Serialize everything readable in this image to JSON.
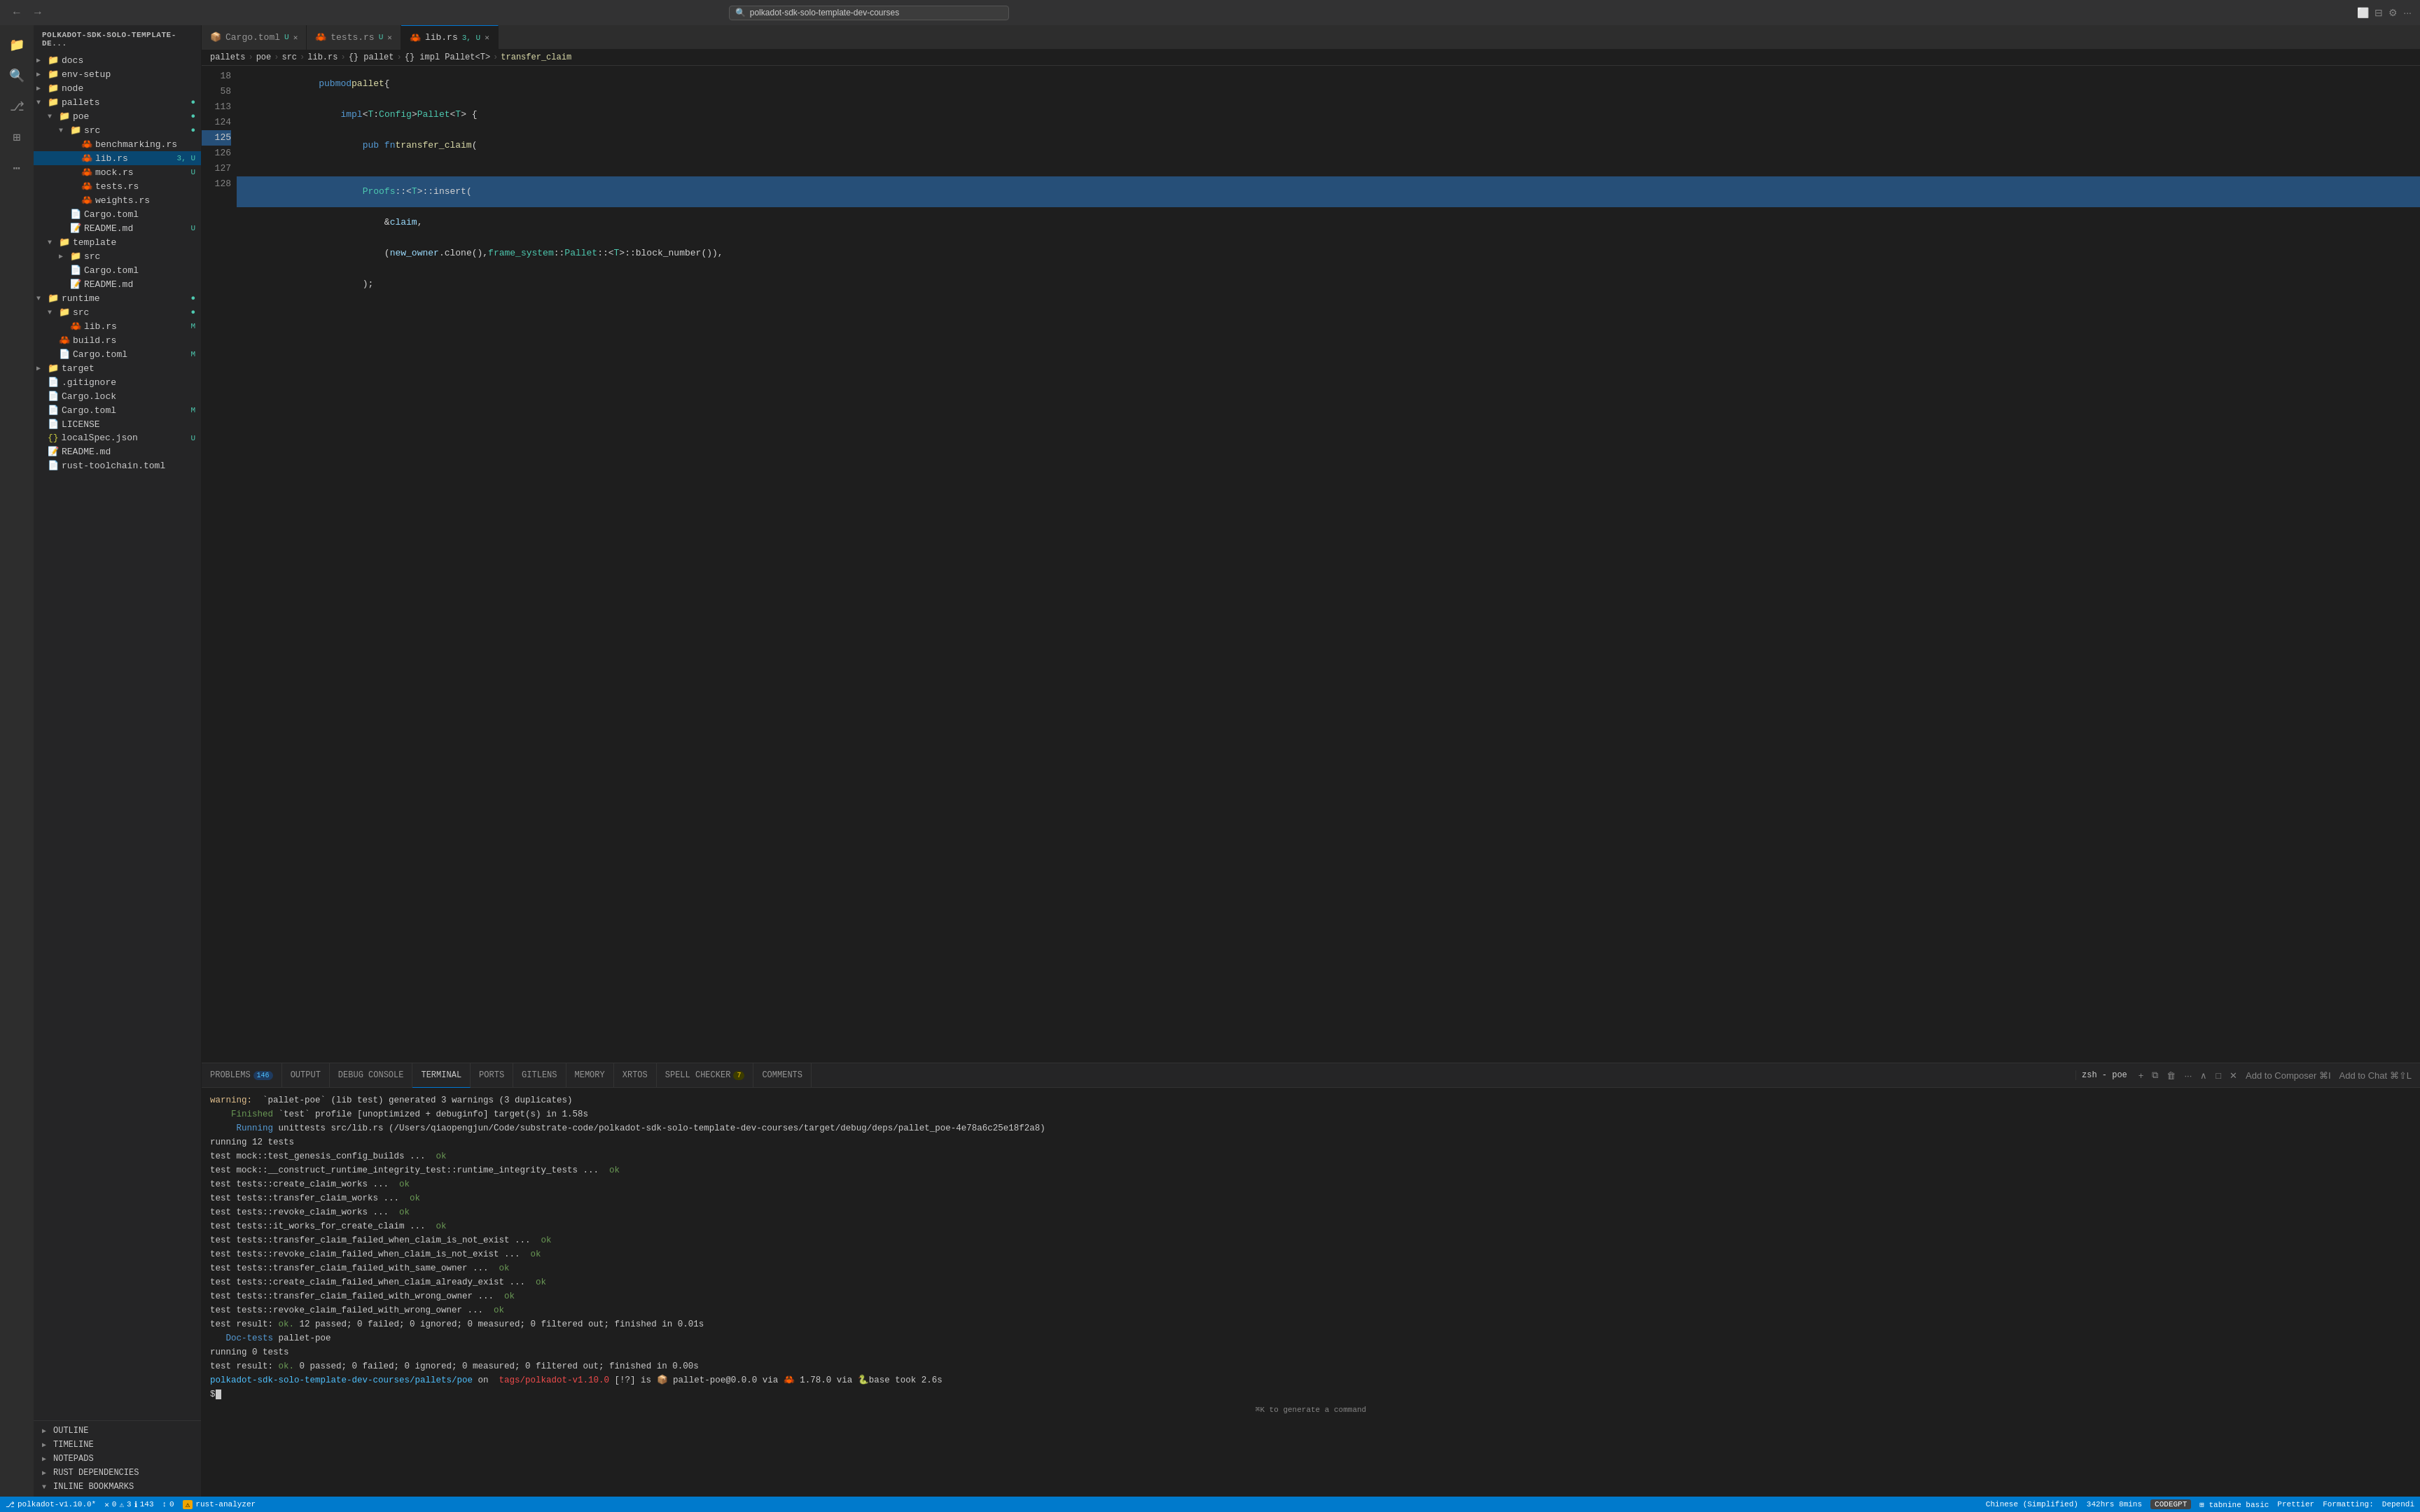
{
  "titlebar": {
    "search_value": "polkadot-sdk-solo-template-dev-courses",
    "search_placeholder": "polkadot-sdk-solo-template-dev-courses"
  },
  "tabs": [
    {
      "id": "cargo-toml",
      "label": "Cargo.toml",
      "badge": "U",
      "active": false,
      "icon": "📦"
    },
    {
      "id": "tests-rs",
      "label": "tests.rs",
      "badge": "U",
      "active": false,
      "icon": "🦀"
    },
    {
      "id": "lib-rs",
      "label": "lib.rs",
      "badge": "3, U",
      "active": true,
      "icon": "🦀"
    }
  ],
  "breadcrumb": {
    "items": [
      "pallets",
      "poe",
      "src",
      "lib.rs",
      "{} pallet",
      "{} impl Pallet<T>",
      "transfer_claim"
    ]
  },
  "sidebar": {
    "title": "POLKADOT-SDK-SOLO-TEMPLATE-DE...",
    "tree": [
      {
        "id": "docs",
        "label": "docs",
        "type": "folder",
        "depth": 0,
        "expanded": false,
        "badge": ""
      },
      {
        "id": "env-setup",
        "label": "env-setup",
        "type": "folder",
        "depth": 0,
        "expanded": false,
        "badge": ""
      },
      {
        "id": "node",
        "label": "node",
        "type": "folder",
        "depth": 0,
        "expanded": false,
        "badge": ""
      },
      {
        "id": "pallets",
        "label": "pallets",
        "type": "folder",
        "depth": 0,
        "expanded": true,
        "badge": "●"
      },
      {
        "id": "poe",
        "label": "poe",
        "type": "folder",
        "depth": 1,
        "expanded": true,
        "badge": "●"
      },
      {
        "id": "src",
        "label": "src",
        "type": "folder",
        "depth": 2,
        "expanded": true,
        "badge": "●"
      },
      {
        "id": "benchmarking-rs",
        "label": "benchmarking.rs",
        "type": "file-rust",
        "depth": 3,
        "expanded": false,
        "badge": ""
      },
      {
        "id": "lib-rs",
        "label": "lib.rs",
        "type": "file-rust",
        "depth": 3,
        "expanded": false,
        "badge": "3, U",
        "selected": true
      },
      {
        "id": "mock-rs",
        "label": "mock.rs",
        "type": "file-rust",
        "depth": 3,
        "expanded": false,
        "badge": "U"
      },
      {
        "id": "tests-rs",
        "label": "tests.rs",
        "type": "file-rust",
        "depth": 3,
        "expanded": false,
        "badge": ""
      },
      {
        "id": "weights-rs",
        "label": "weights.rs",
        "type": "file-rust",
        "depth": 3,
        "expanded": false,
        "badge": ""
      },
      {
        "id": "cargo-toml-poe",
        "label": "Cargo.toml",
        "type": "file-toml",
        "depth": 2,
        "expanded": false,
        "badge": ""
      },
      {
        "id": "readme-poe",
        "label": "README.md",
        "type": "file-md",
        "depth": 2,
        "expanded": false,
        "badge": "U"
      },
      {
        "id": "template",
        "label": "template",
        "type": "folder",
        "depth": 1,
        "expanded": true,
        "badge": ""
      },
      {
        "id": "template-src",
        "label": "src",
        "type": "folder",
        "depth": 2,
        "expanded": false,
        "badge": ""
      },
      {
        "id": "template-cargo",
        "label": "Cargo.toml",
        "type": "file-toml",
        "depth": 2,
        "expanded": false,
        "badge": ""
      },
      {
        "id": "template-readme",
        "label": "README.md",
        "type": "file-md",
        "depth": 2,
        "expanded": false,
        "badge": ""
      },
      {
        "id": "runtime",
        "label": "runtime",
        "type": "folder",
        "depth": 0,
        "expanded": true,
        "badge": "●"
      },
      {
        "id": "runtime-src",
        "label": "src",
        "type": "folder",
        "depth": 1,
        "expanded": true,
        "badge": "●"
      },
      {
        "id": "runtime-lib-rs",
        "label": "lib.rs",
        "type": "file-rust",
        "depth": 2,
        "expanded": false,
        "badge": "M"
      },
      {
        "id": "build-rs",
        "label": "build.rs",
        "type": "file-rust",
        "depth": 1,
        "expanded": false,
        "badge": ""
      },
      {
        "id": "runtime-cargo",
        "label": "Cargo.toml",
        "type": "file-toml",
        "depth": 1,
        "expanded": false,
        "badge": "M"
      },
      {
        "id": "target",
        "label": "target",
        "type": "folder",
        "depth": 0,
        "expanded": false,
        "badge": ""
      },
      {
        "id": "gitignore",
        "label": ".gitignore",
        "type": "file",
        "depth": 0,
        "expanded": false,
        "badge": ""
      },
      {
        "id": "cargo-lock",
        "label": "Cargo.lock",
        "type": "file",
        "depth": 0,
        "expanded": false,
        "badge": ""
      },
      {
        "id": "cargo-toml-root",
        "label": "Cargo.toml",
        "type": "file-toml",
        "depth": 0,
        "expanded": false,
        "badge": "M"
      },
      {
        "id": "license",
        "label": "LICENSE",
        "type": "file",
        "depth": 0,
        "expanded": false,
        "badge": ""
      },
      {
        "id": "local-spec-json",
        "label": "localSpec.json",
        "type": "file-json",
        "depth": 0,
        "expanded": false,
        "badge": "U"
      },
      {
        "id": "readme-root",
        "label": "README.md",
        "type": "file-md",
        "depth": 0,
        "expanded": false,
        "badge": ""
      },
      {
        "id": "rust-toolchain",
        "label": "rust-toolchain.toml",
        "type": "file-toml",
        "depth": 0,
        "expanded": false,
        "badge": ""
      }
    ]
  },
  "outline_items": [
    "OUTLINE",
    "TIMELINE",
    "NOTEPADS",
    "RUST DEPENDENCIES",
    "INLINE BOOKMARKS"
  ],
  "code": {
    "lines": [
      {
        "num": "18",
        "content": "    pub mod pallet {",
        "highlight": false
      },
      {
        "num": "58",
        "content": "        impl<T: Config> Pallet<T> {",
        "highlight": false
      },
      {
        "num": "113",
        "content": "            pub fn transfer_claim(",
        "highlight": false
      },
      {
        "num": "124",
        "content": "",
        "highlight": false
      },
      {
        "num": "125",
        "content": "            Proofs::<T>::insert(",
        "highlight": true
      },
      {
        "num": "126",
        "content": "                &claim,",
        "highlight": false
      },
      {
        "num": "127",
        "content": "                (new_owner.clone(), frame_system::Pallet::<T>::block_number()),",
        "highlight": false
      },
      {
        "num": "128",
        "content": "            );",
        "highlight": false
      }
    ]
  },
  "terminal": {
    "tabs": [
      {
        "id": "problems",
        "label": "PROBLEMS",
        "badge": "146",
        "active": false
      },
      {
        "id": "output",
        "label": "OUTPUT",
        "badge": "",
        "active": false
      },
      {
        "id": "debug-console",
        "label": "DEBUG CONSOLE",
        "badge": "",
        "active": false
      },
      {
        "id": "terminal",
        "label": "TERMINAL",
        "badge": "",
        "active": true
      },
      {
        "id": "ports",
        "label": "PORTS",
        "badge": "",
        "active": false
      },
      {
        "id": "gitlens",
        "label": "GITLENS",
        "badge": "",
        "active": false
      },
      {
        "id": "memory",
        "label": "MEMORY",
        "badge": "",
        "active": false
      },
      {
        "id": "xrtos",
        "label": "XRTOS",
        "badge": "",
        "active": false
      },
      {
        "id": "spell-checker",
        "label": "SPELL CHECKER",
        "badge": "7",
        "active": false
      },
      {
        "id": "comments",
        "label": "COMMENTS",
        "badge": "",
        "active": false
      }
    ],
    "current_shell": "zsh - poe",
    "add_composer_label": "Add to Composer  ⌘I",
    "add_chat_label": "Add to Chat  ⌘⇧L",
    "output": [
      "warning: `pallet-poe` (lib test) generated 3 warnings (3 duplicates)",
      "    Finished `test` profile [unoptimized + debuginfo] target(s) in 1.58s",
      "     Running unittests src/lib.rs (/Users/qiaopengjun/Code/substrate-code/polkadot-sdk-solo-template-dev-courses/target/debug/deps/pallet_poe-4e78a6c25e18f2a8)",
      "",
      "running 12 tests",
      "test mock::test_genesis_config_builds ... ok",
      "test mock::__construct_runtime_integrity_test::runtime_integrity_tests ... ok",
      "test tests::create_claim_works ... ok",
      "test tests::transfer_claim_works ... ok",
      "test tests::revoke_claim_works ... ok",
      "test tests::it_works_for_create_claim ... ok",
      "test tests::transfer_claim_failed_when_claim_is_not_exist ... ok",
      "test tests::revoke_claim_failed_when_claim_is_not_exist ... ok",
      "test tests::transfer_claim_failed_with_same_owner ... ok",
      "test tests::create_claim_failed_when_claim_already_exist ... ok",
      "test tests::transfer_claim_failed_with_wrong_owner ... ok",
      "test tests::revoke_claim_failed_with_wrong_owner ... ok",
      "",
      "test result: ok. 12 passed; 0 failed; 0 ignored; 0 measured; 0 filtered out; finished in 0.01s",
      "",
      "   Doc-tests pallet-poe",
      "",
      "running 0 tests",
      "",
      "test result: ok. 0 passed; 0 failed; 0 ignored; 0 measured; 0 filtered out; finished in 0.00s",
      "",
      "polkadot-sdk-solo-template-dev-courses/pallets/poe on  tags/polkadot-v1.10.0 [!?] is 📦 pallet-poe@0.0.0 via 🦀 1.78.0 via 🐍base took 2.6s"
    ],
    "prompt": "$ "
  },
  "status_bar": {
    "branch": "polkadot-v1.10.0*",
    "errors": "0",
    "warnings": "3",
    "info": "143",
    "sync": "0",
    "rust_analyzer": "rust-analyzer",
    "language": "Chinese (Simplified)",
    "time": "342hrs 8mins",
    "codegpt": "CODEGPT",
    "tabnine": "tabnine basic",
    "prettier": "Prettier",
    "formatting": "Formatting:",
    "dependi": "Dependi"
  }
}
